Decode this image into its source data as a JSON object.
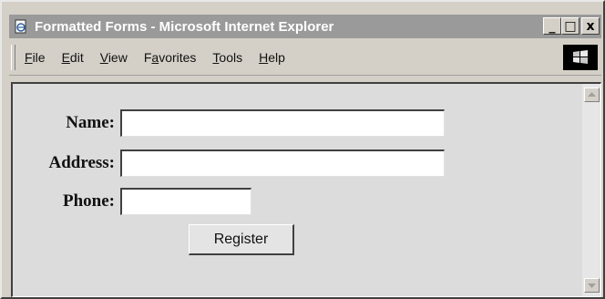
{
  "window": {
    "title": "Formatted Forms - Microsoft Internet Explorer",
    "buttons": {
      "minimize": "_",
      "maximize": "□",
      "close": "x"
    }
  },
  "menu": {
    "items": [
      {
        "pre": "",
        "u": "F",
        "post": "ile"
      },
      {
        "pre": "",
        "u": "E",
        "post": "dit"
      },
      {
        "pre": "",
        "u": "V",
        "post": "iew"
      },
      {
        "pre": "F",
        "u": "a",
        "post": "vorites"
      },
      {
        "pre": "",
        "u": "T",
        "post": "ools"
      },
      {
        "pre": "",
        "u": "H",
        "post": "elp"
      }
    ]
  },
  "form": {
    "name_label": "Name:",
    "name_value": "",
    "address_label": "Address:",
    "address_value": "",
    "phone_label": "Phone:",
    "phone_value": "",
    "register_label": "Register"
  },
  "icons": {
    "app": "ie-page-icon",
    "brand": "windows-logo-icon",
    "scroll_up": "scroll-up-arrow-icon",
    "scroll_down": "scroll-down-arrow-icon"
  }
}
